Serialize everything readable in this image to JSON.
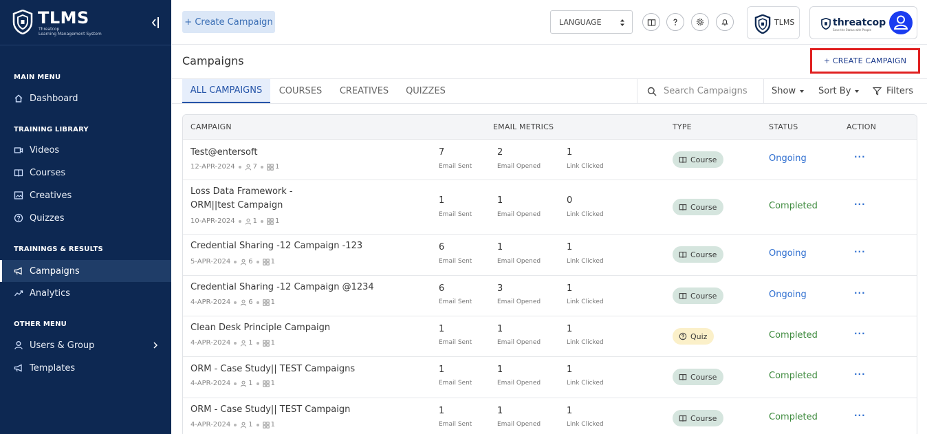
{
  "sidebar": {
    "brand_title": "TLMS",
    "brand_sub1": "Threatcop",
    "brand_sub2": "Learning Management System",
    "sections": {
      "main_menu": "MAIN MENU",
      "training_library": "TRAINING LIBRARY",
      "trainings_results": "TRAININGS & RESULTS",
      "other_menu": "OTHER MENU"
    },
    "items": {
      "dashboard": "Dashboard",
      "videos": "Videos",
      "courses": "Courses",
      "creatives": "Creatives",
      "quizzes": "Quizzes",
      "campaigns": "Campaigns",
      "analytics": "Analytics",
      "users_group": "Users & Group",
      "templates": "Templates"
    }
  },
  "header": {
    "create_label": "+ Create Campaign",
    "language_label": "LANGUAGE",
    "tlms_label": "TLMS",
    "brand_name": "threatcop",
    "brand_tagline": "Save the Status with People"
  },
  "page": {
    "title": "Campaigns",
    "create_campaign_label": "+ CREATE CAMPAIGN"
  },
  "tabs": [
    "ALL CAMPAIGNS",
    "COURSES",
    "CREATIVES",
    "QUIZZES"
  ],
  "toolbar": {
    "search_placeholder": "Search Campaigns",
    "show_label": "Show",
    "sort_label": "Sort By",
    "filters_label": "Filters"
  },
  "table": {
    "headers": {
      "campaign": "CAMPAIGN",
      "metrics": "EMAIL METRICS",
      "type": "TYPE",
      "status": "STATUS",
      "action": "ACTION"
    },
    "metric_labels": {
      "sent": "Email Sent",
      "opened": "Email Opened",
      "clicked": "Link Clicked"
    },
    "action_label": "···",
    "rows": [
      {
        "name": "Test@entersoft",
        "date": "12-APR-2024",
        "users": "7",
        "groups": "1",
        "sent": "7",
        "opened": "2",
        "clicked": "1",
        "type": "Course",
        "status": "Ongoing"
      },
      {
        "name": "Loss Data Framework - ORM||test Campaign",
        "date": "10-APR-2024",
        "users": "1",
        "groups": "1",
        "sent": "1",
        "opened": "1",
        "clicked": "0",
        "type": "Course",
        "status": "Completed"
      },
      {
        "name": "Credential Sharing -12 Campaign -123",
        "date": "5-APR-2024",
        "users": "6",
        "groups": "1",
        "sent": "6",
        "opened": "1",
        "clicked": "1",
        "type": "Course",
        "status": "Ongoing"
      },
      {
        "name": "Credential Sharing -12 Campaign @1234",
        "date": "4-APR-2024",
        "users": "6",
        "groups": "1",
        "sent": "6",
        "opened": "3",
        "clicked": "1",
        "type": "Course",
        "status": "Ongoing"
      },
      {
        "name": "Clean Desk Principle Campaign",
        "date": "4-APR-2024",
        "users": "1",
        "groups": "1",
        "sent": "1",
        "opened": "1",
        "clicked": "1",
        "type": "Quiz",
        "status": "Completed"
      },
      {
        "name": "ORM - Case Study|| TEST Campaigns",
        "date": "4-APR-2024",
        "users": "1",
        "groups": "1",
        "sent": "1",
        "opened": "1",
        "clicked": "1",
        "type": "Course",
        "status": "Completed"
      },
      {
        "name": "ORM - Case Study|| TEST Campaign",
        "date": "4-APR-2024",
        "users": "1",
        "groups": "1",
        "sent": "1",
        "opened": "1",
        "clicked": "1",
        "type": "Course",
        "status": "Completed"
      }
    ]
  }
}
